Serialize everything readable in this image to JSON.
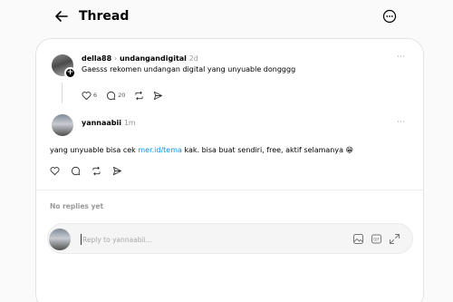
{
  "header": {
    "title": "Thread",
    "back_icon": "arrow-left-icon",
    "more_icon": "more-circle-icon"
  },
  "original_post": {
    "author": "della88",
    "separator": "›",
    "reply_to": "undangandigital",
    "time": "2d",
    "text": "Gaesss rekomen undangan digital yang unyuable dongggg",
    "likes": "6",
    "comments": "20"
  },
  "reply": {
    "author": "yannaabii",
    "time": "1m",
    "text_before": "yang unyuable bisa cek ",
    "link": "mer.id/tema",
    "text_after": " kak. bisa buat sendiri, free, aktif selamanya ",
    "emoji": "😁"
  },
  "replies_section": {
    "empty_label": "No replies yet"
  },
  "composer": {
    "placeholder": "Reply to yannaabii..."
  },
  "colors": {
    "link": "#0095f6",
    "muted": "#999999",
    "card_border": "#e3e3e3"
  }
}
